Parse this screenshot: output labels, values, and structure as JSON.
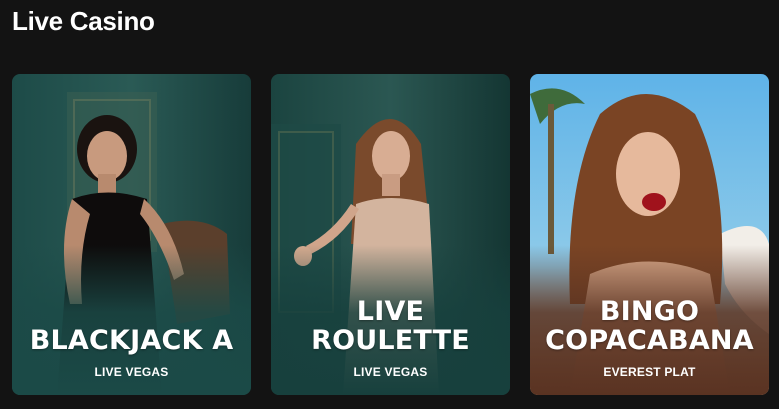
{
  "section": {
    "title": "Live Casino"
  },
  "cards": [
    {
      "title": "BLACKJACK A",
      "provider": "LIVE VEGAS",
      "theme_color": "#1b4a47"
    },
    {
      "title": "LIVE\nROULETTE",
      "provider": "LIVE VEGAS",
      "theme_color": "#17403d"
    },
    {
      "title": "BINGO\nCOPACABANA",
      "provider": "EVEREST PLAT",
      "theme_color": "#5a3322"
    }
  ]
}
